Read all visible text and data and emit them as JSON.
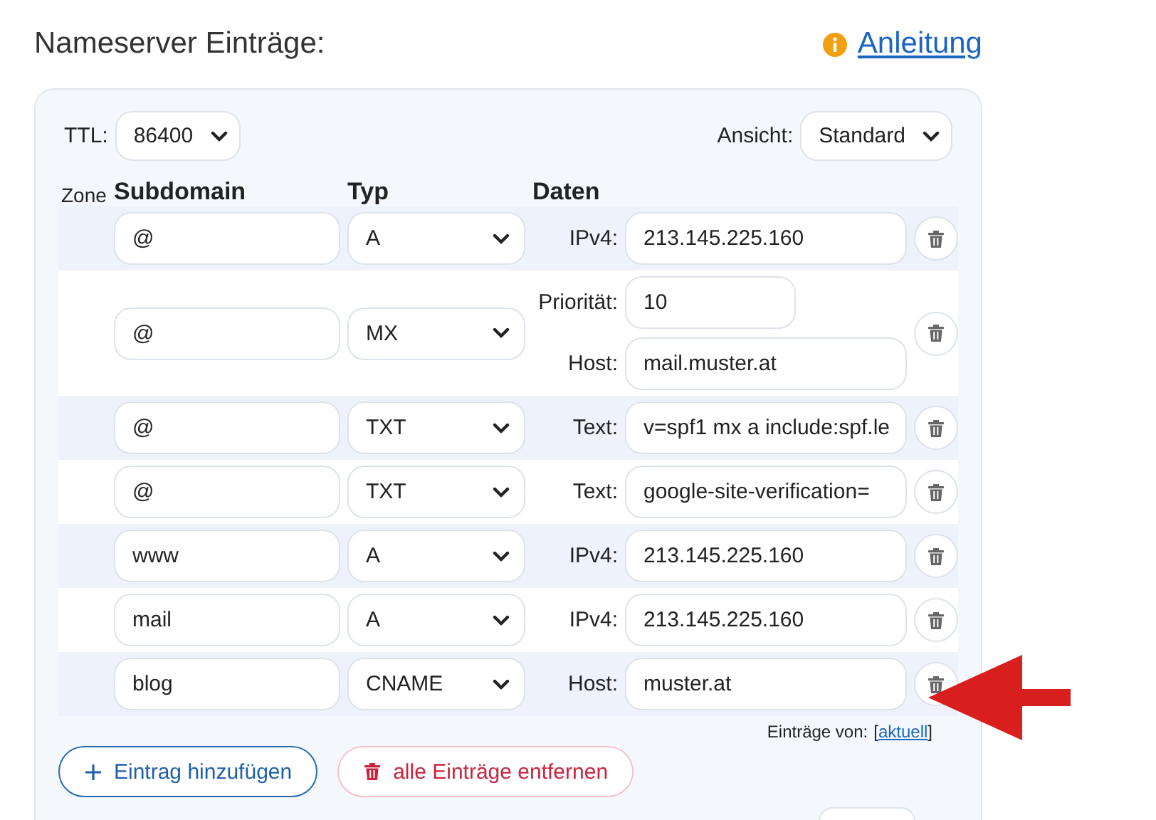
{
  "heading": "Nameserver Einträge:",
  "help_link": "Anleitung",
  "ttl": {
    "label": "TTL:",
    "value": "86400"
  },
  "view": {
    "label": "Ansicht:",
    "value": "Standard"
  },
  "columns": {
    "zone": "Zone",
    "subdomain": "Subdomain",
    "type": "Typ",
    "data": "Daten"
  },
  "rows": [
    {
      "subdomain": "@",
      "type": "A",
      "fields": [
        {
          "kind": "text",
          "label": "IPv4:",
          "value": "213.145.225.160"
        }
      ]
    },
    {
      "subdomain": "@",
      "type": "MX",
      "fields": [
        {
          "kind": "number",
          "label": "Priorität:",
          "value": "10"
        },
        {
          "kind": "text",
          "label": "Host:",
          "value": "mail.muster.at"
        }
      ]
    },
    {
      "subdomain": "@",
      "type": "TXT",
      "fields": [
        {
          "kind": "text",
          "label": "Text:",
          "value": "v=spf1 mx a include:spf.le"
        }
      ]
    },
    {
      "subdomain": "@",
      "type": "TXT",
      "fields": [
        {
          "kind": "text",
          "label": "Text:",
          "value": "google-site-verification="
        }
      ]
    },
    {
      "subdomain": "www",
      "type": "A",
      "fields": [
        {
          "kind": "text",
          "label": "IPv4:",
          "value": "213.145.225.160"
        }
      ]
    },
    {
      "subdomain": "mail",
      "type": "A",
      "fields": [
        {
          "kind": "text",
          "label": "IPv4:",
          "value": "213.145.225.160"
        }
      ]
    },
    {
      "subdomain": "blog",
      "type": "CNAME",
      "fields": [
        {
          "kind": "text",
          "label": "Host:",
          "value": "muster.at"
        }
      ]
    }
  ],
  "entries_from": {
    "label": "Einträge von:",
    "open_bracket": "[",
    "link": "aktuell",
    "close_bracket": "]"
  },
  "buttons": {
    "add": "Eintrag hinzufügen",
    "remove_all": "alle Einträge entfernen"
  }
}
